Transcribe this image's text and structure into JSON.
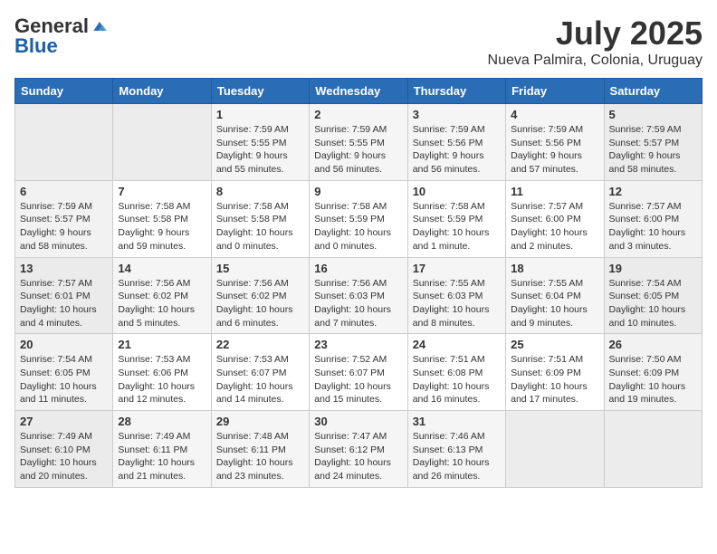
{
  "header": {
    "logo": {
      "general": "General",
      "blue": "Blue"
    },
    "title": "July 2025",
    "location": "Nueva Palmira, Colonia, Uruguay"
  },
  "calendar": {
    "weekdays": [
      "Sunday",
      "Monday",
      "Tuesday",
      "Wednesday",
      "Thursday",
      "Friday",
      "Saturday"
    ],
    "weeks": [
      [
        {
          "day": "",
          "info": ""
        },
        {
          "day": "",
          "info": ""
        },
        {
          "day": "1",
          "info": "Sunrise: 7:59 AM\nSunset: 5:55 PM\nDaylight: 9 hours\nand 55 minutes."
        },
        {
          "day": "2",
          "info": "Sunrise: 7:59 AM\nSunset: 5:55 PM\nDaylight: 9 hours\nand 56 minutes."
        },
        {
          "day": "3",
          "info": "Sunrise: 7:59 AM\nSunset: 5:56 PM\nDaylight: 9 hours\nand 56 minutes."
        },
        {
          "day": "4",
          "info": "Sunrise: 7:59 AM\nSunset: 5:56 PM\nDaylight: 9 hours\nand 57 minutes."
        },
        {
          "day": "5",
          "info": "Sunrise: 7:59 AM\nSunset: 5:57 PM\nDaylight: 9 hours\nand 58 minutes."
        }
      ],
      [
        {
          "day": "6",
          "info": "Sunrise: 7:59 AM\nSunset: 5:57 PM\nDaylight: 9 hours\nand 58 minutes."
        },
        {
          "day": "7",
          "info": "Sunrise: 7:58 AM\nSunset: 5:58 PM\nDaylight: 9 hours\nand 59 minutes."
        },
        {
          "day": "8",
          "info": "Sunrise: 7:58 AM\nSunset: 5:58 PM\nDaylight: 10 hours\nand 0 minutes."
        },
        {
          "day": "9",
          "info": "Sunrise: 7:58 AM\nSunset: 5:59 PM\nDaylight: 10 hours\nand 0 minutes."
        },
        {
          "day": "10",
          "info": "Sunrise: 7:58 AM\nSunset: 5:59 PM\nDaylight: 10 hours\nand 1 minute."
        },
        {
          "day": "11",
          "info": "Sunrise: 7:57 AM\nSunset: 6:00 PM\nDaylight: 10 hours\nand 2 minutes."
        },
        {
          "day": "12",
          "info": "Sunrise: 7:57 AM\nSunset: 6:00 PM\nDaylight: 10 hours\nand 3 minutes."
        }
      ],
      [
        {
          "day": "13",
          "info": "Sunrise: 7:57 AM\nSunset: 6:01 PM\nDaylight: 10 hours\nand 4 minutes."
        },
        {
          "day": "14",
          "info": "Sunrise: 7:56 AM\nSunset: 6:02 PM\nDaylight: 10 hours\nand 5 minutes."
        },
        {
          "day": "15",
          "info": "Sunrise: 7:56 AM\nSunset: 6:02 PM\nDaylight: 10 hours\nand 6 minutes."
        },
        {
          "day": "16",
          "info": "Sunrise: 7:56 AM\nSunset: 6:03 PM\nDaylight: 10 hours\nand 7 minutes."
        },
        {
          "day": "17",
          "info": "Sunrise: 7:55 AM\nSunset: 6:03 PM\nDaylight: 10 hours\nand 8 minutes."
        },
        {
          "day": "18",
          "info": "Sunrise: 7:55 AM\nSunset: 6:04 PM\nDaylight: 10 hours\nand 9 minutes."
        },
        {
          "day": "19",
          "info": "Sunrise: 7:54 AM\nSunset: 6:05 PM\nDaylight: 10 hours\nand 10 minutes."
        }
      ],
      [
        {
          "day": "20",
          "info": "Sunrise: 7:54 AM\nSunset: 6:05 PM\nDaylight: 10 hours\nand 11 minutes."
        },
        {
          "day": "21",
          "info": "Sunrise: 7:53 AM\nSunset: 6:06 PM\nDaylight: 10 hours\nand 12 minutes."
        },
        {
          "day": "22",
          "info": "Sunrise: 7:53 AM\nSunset: 6:07 PM\nDaylight: 10 hours\nand 14 minutes."
        },
        {
          "day": "23",
          "info": "Sunrise: 7:52 AM\nSunset: 6:07 PM\nDaylight: 10 hours\nand 15 minutes."
        },
        {
          "day": "24",
          "info": "Sunrise: 7:51 AM\nSunset: 6:08 PM\nDaylight: 10 hours\nand 16 minutes."
        },
        {
          "day": "25",
          "info": "Sunrise: 7:51 AM\nSunset: 6:09 PM\nDaylight: 10 hours\nand 17 minutes."
        },
        {
          "day": "26",
          "info": "Sunrise: 7:50 AM\nSunset: 6:09 PM\nDaylight: 10 hours\nand 19 minutes."
        }
      ],
      [
        {
          "day": "27",
          "info": "Sunrise: 7:49 AM\nSunset: 6:10 PM\nDaylight: 10 hours\nand 20 minutes."
        },
        {
          "day": "28",
          "info": "Sunrise: 7:49 AM\nSunset: 6:11 PM\nDaylight: 10 hours\nand 21 minutes."
        },
        {
          "day": "29",
          "info": "Sunrise: 7:48 AM\nSunset: 6:11 PM\nDaylight: 10 hours\nand 23 minutes."
        },
        {
          "day": "30",
          "info": "Sunrise: 7:47 AM\nSunset: 6:12 PM\nDaylight: 10 hours\nand 24 minutes."
        },
        {
          "day": "31",
          "info": "Sunrise: 7:46 AM\nSunset: 6:13 PM\nDaylight: 10 hours\nand 26 minutes."
        },
        {
          "day": "",
          "info": ""
        },
        {
          "day": "",
          "info": ""
        }
      ]
    ]
  }
}
